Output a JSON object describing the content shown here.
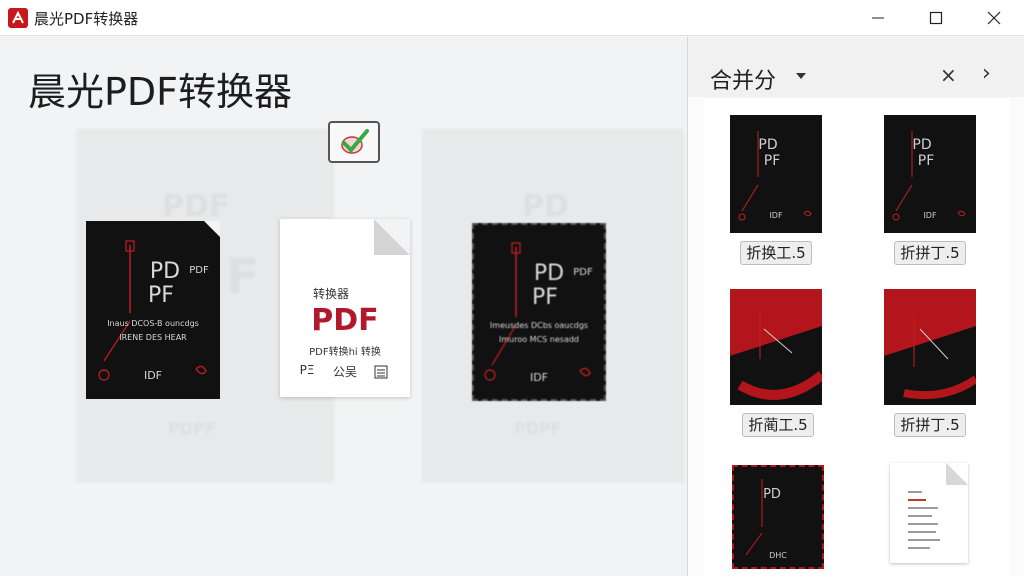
{
  "window": {
    "title": "晨光PDF转换器",
    "icons": {
      "app": "app-logo-icon",
      "minimize": "minimize-icon",
      "maximize": "maximize-icon",
      "close": "close-icon"
    }
  },
  "main": {
    "heading": "晨光PDF转换器",
    "check_icon": "checkbox-checked-icon",
    "docs": {
      "left": {
        "pd": "PD",
        "pdf_small": "PDF",
        "pf": "PF",
        "line1": "Inaus DCOS-B ouncdgs",
        "line2": "IRENE DES HEAR",
        "footer": "IDF"
      },
      "center": {
        "header": "转换器",
        "pdf": "PDF",
        "subtext": "PDF转换hi 转换",
        "footer_left": "PΞ",
        "footer_mid": "公吴"
      },
      "right": {
        "pd": "PD",
        "pdf_small": "PDF",
        "pf": "PF",
        "line1": "Imeusdes DCbs oaucdgs",
        "line2": "Imuroo MCS nesadd",
        "footer": "IDF"
      }
    },
    "ghost": {
      "left_top": "PDF",
      "left_mid": "F",
      "left_bottom": "PDPF",
      "right_top": "PD",
      "right_mid": "F",
      "right_bottom": "PDPF"
    },
    "colors": {
      "accent": "#b2182b",
      "check_green": "#39a845"
    }
  },
  "panel": {
    "title": "合并分",
    "close_glyph": "×",
    "next_glyph": "›",
    "thumbnails": [
      {
        "label": "折换工.5",
        "style": "dark"
      },
      {
        "label": "折拼丁.5",
        "style": "dark"
      },
      {
        "label": "折蔺工.5",
        "style": "red"
      },
      {
        "label": "折拼丁.5",
        "style": "red"
      },
      {
        "label": "",
        "style": "dark"
      },
      {
        "label": "",
        "style": "white"
      }
    ],
    "thumb_text": {
      "pd": "PD",
      "pf": "PF",
      "idf": "IDF",
      "dhc": "DHC"
    }
  }
}
